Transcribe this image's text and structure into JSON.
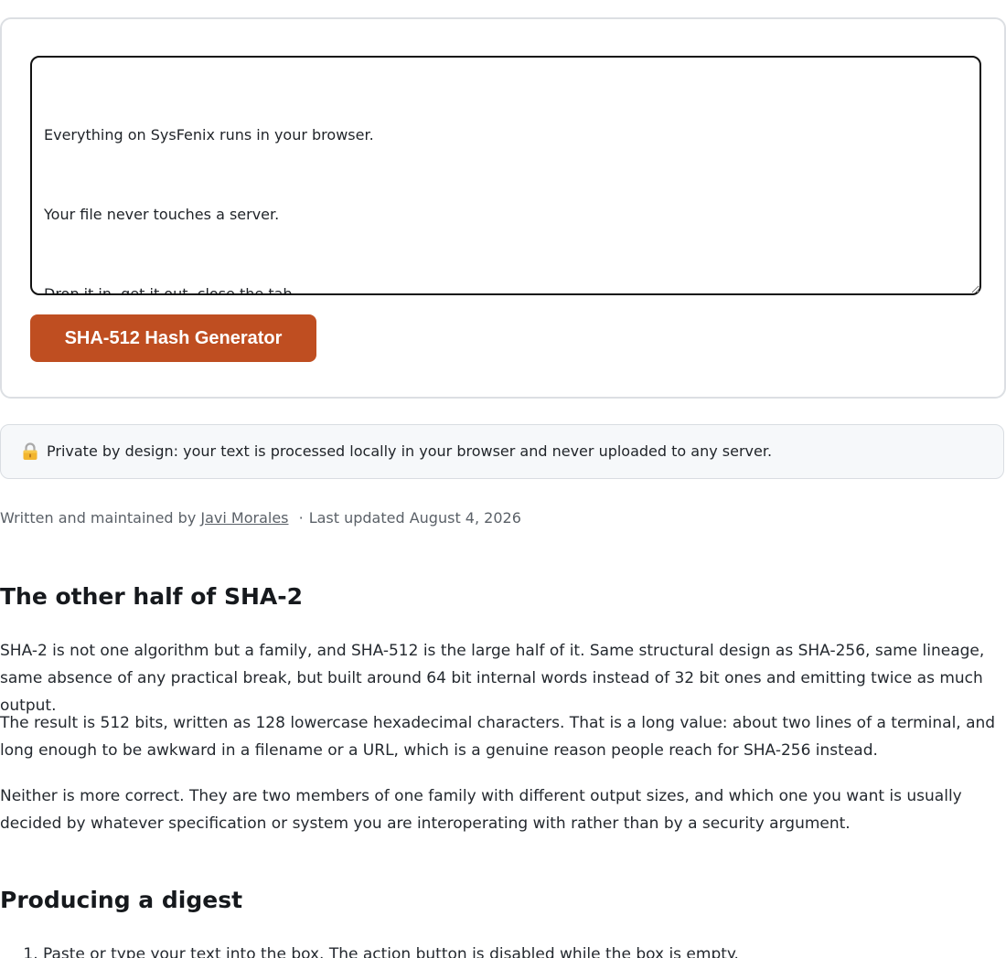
{
  "tool": {
    "input_lines": [
      "Everything on SysFenix runs in your browser.",
      "Your file never touches a server.",
      "Drop it in, get it out, close the tab."
    ],
    "button_label": "SHA-512 Hash Generator",
    "button_color": "#bf4e21"
  },
  "privacy": {
    "icon": "lock-icon",
    "text": "Private by design: your text is processed locally in your browser and never uploaded to any server."
  },
  "byline": {
    "prefix": "Written and maintained by",
    "author": "Javi Morales",
    "separator": "·",
    "updated": "Last updated August 4, 2026"
  },
  "article": {
    "section1": {
      "heading": "The other half of SHA-2",
      "paragraphs": [
        "SHA-2 is not one algorithm but a family, and SHA-512 is the large half of it. Same structural design as SHA-256, same lineage, same absence of any practical break, but built around 64 bit internal words instead of 32 bit ones and emitting twice as much output.",
        "The result is 512 bits, written as 128 lowercase hexadecimal characters. That is a long value: about two lines of a terminal, and long enough to be awkward in a filename or a URL, which is a genuine reason people reach for SHA-256 instead.",
        "Neither is more correct. They are two members of one family with different output sizes, and which one you want is usually decided by whatever specification or system you are interoperating with rather than by a security argument."
      ]
    },
    "section2": {
      "heading": "Producing a digest",
      "steps": [
        "Paste or type your text into the box. The action button is disabled while the box is empty."
      ]
    }
  }
}
